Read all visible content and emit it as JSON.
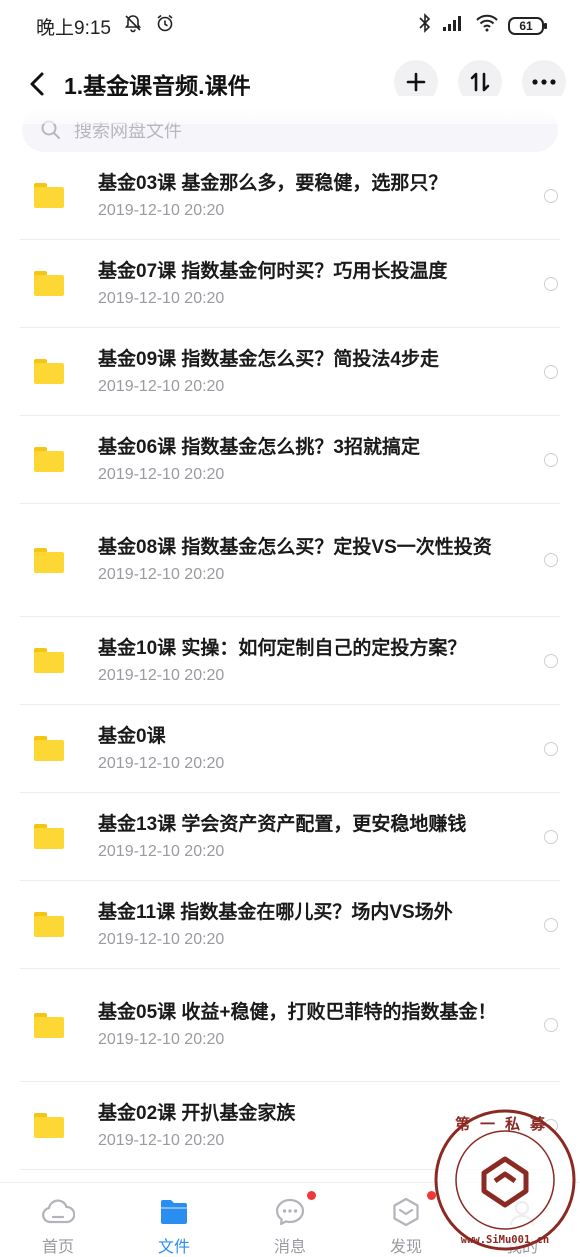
{
  "status": {
    "time": "晚上9:15",
    "battery": "61"
  },
  "header": {
    "title": "1.基金课音频.课件"
  },
  "search": {
    "placeholder": "搜索网盘文件"
  },
  "files": [
    {
      "name": "基金03课 基金那么多，要稳健，选那只？",
      "date": "2019-12-10  20:20"
    },
    {
      "name": "基金07课 指数基金何时买？巧用长投温度",
      "date": "2019-12-10  20:20"
    },
    {
      "name": "基金09课 指数基金怎么买？简投法4步走",
      "date": "2019-12-10  20:20"
    },
    {
      "name": "基金06课 指数基金怎么挑？3招就搞定",
      "date": "2019-12-10  20:20"
    },
    {
      "name": "基金08课  指数基金怎么买？定投VS一次性投资",
      "date": "2019-12-10  20:20"
    },
    {
      "name": "基金10课 实操：如何定制自己的定投方案？",
      "date": "2019-12-10  20:20"
    },
    {
      "name": "基金0课",
      "date": "2019-12-10  20:20"
    },
    {
      "name": "基金13课 学会资产资产配置，更安稳地赚钱",
      "date": "2019-12-10  20:20"
    },
    {
      "name": "基金11课 指数基金在哪儿买？场内VS场外",
      "date": "2019-12-10  20:20"
    },
    {
      "name": "基金05课 收益+稳健，打败巴菲特的指数基金！",
      "date": "2019-12-10  20:20"
    },
    {
      "name": "基金02课 开扒基金家族",
      "date": "2019-12-10  20:20"
    }
  ],
  "nav": [
    {
      "label": "首页",
      "icon": "cloud-icon"
    },
    {
      "label": "文件",
      "icon": "folder-icon"
    },
    {
      "label": "消息",
      "icon": "chat-icon"
    },
    {
      "label": "发现",
      "icon": "cube-icon"
    },
    {
      "label": "我的",
      "icon": "person-icon"
    }
  ],
  "watermark": {
    "top_text": "第一私募",
    "url_text": "www.SiMu001.cn"
  },
  "colors": {
    "accent": "#2a8ef0",
    "folder": "#fdd835",
    "badge": "#f0373a"
  }
}
